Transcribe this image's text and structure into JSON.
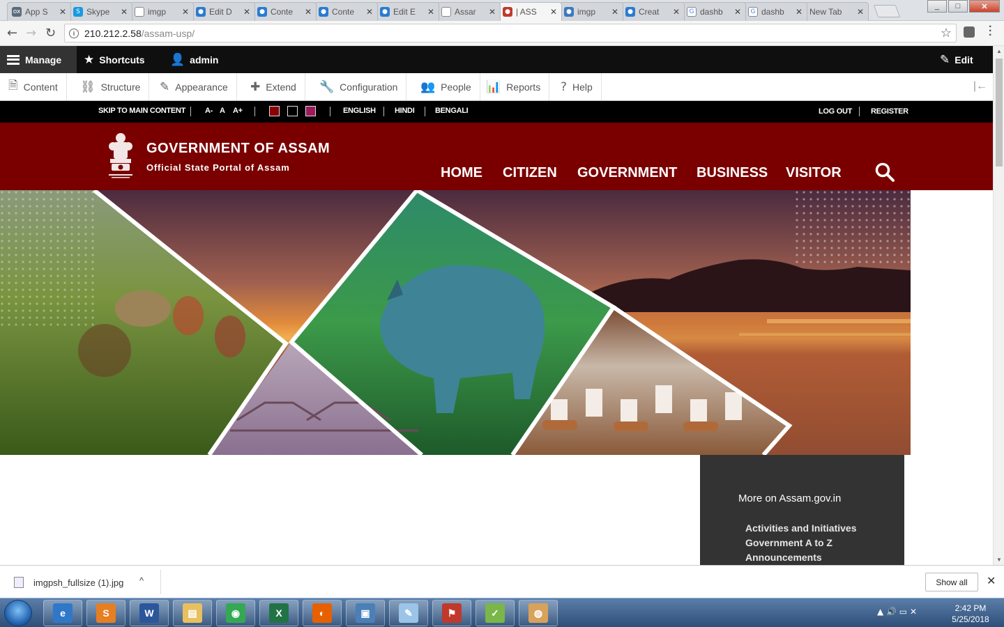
{
  "browser": {
    "tabs": [
      {
        "title": "App S",
        "color": "#5a6b7a",
        "glyph": "ox"
      },
      {
        "title": "Skype",
        "color": "#1a9ae0",
        "glyph": "S"
      },
      {
        "title": "imgp",
        "color": "#ffffff",
        "glyph": ""
      },
      {
        "title": "Edit D",
        "color": "#2a7bd1",
        "glyph": "●"
      },
      {
        "title": "Conte",
        "color": "#2a7bd1",
        "glyph": "●"
      },
      {
        "title": "Conte",
        "color": "#2a7bd1",
        "glyph": "●"
      },
      {
        "title": "Edit E",
        "color": "#2a7bd1",
        "glyph": "●"
      },
      {
        "title": "Assar",
        "color": "#ffffff",
        "glyph": ""
      },
      {
        "title": "| ASS",
        "color": "#c0392b",
        "glyph": "●"
      },
      {
        "title": "imgp",
        "color": "#3a79c0",
        "glyph": "●"
      },
      {
        "title": "Creat",
        "color": "#2a7bd1",
        "glyph": "●"
      },
      {
        "title": "dashb",
        "color": "#ffffff",
        "glyph": "G"
      },
      {
        "title": "dashb",
        "color": "#ffffff",
        "glyph": "G"
      },
      {
        "title": "New Tab",
        "color": "",
        "glyph": ""
      }
    ],
    "tab_close": "✕",
    "url_host": "210.212.2.58",
    "url_path": "/assam-usp/",
    "info_glyph": "i",
    "star_glyph": "☆",
    "back_glyph": "←",
    "forward_glyph": "→",
    "reload_glyph": "↻",
    "min_glyph": "_",
    "max_glyph": "□",
    "close_glyph": "✕"
  },
  "admin_toolbar": {
    "manage": "Manage",
    "shortcuts": "Shortcuts",
    "user": "admin",
    "edit": "Edit",
    "star_glyph": "★",
    "user_glyph": "👤",
    "pencil_glyph": "✎"
  },
  "admin_tray": {
    "items": [
      {
        "label": "Content",
        "glyph": "🗎"
      },
      {
        "label": "Structure",
        "glyph": "⛓"
      },
      {
        "label": "Appearance",
        "glyph": "✎"
      },
      {
        "label": "Extend",
        "glyph": "✚"
      },
      {
        "label": "Configuration",
        "glyph": "🔧"
      },
      {
        "label": "People",
        "glyph": "👥"
      },
      {
        "label": "Reports",
        "glyph": "📊"
      },
      {
        "label": "Help",
        "glyph": "?"
      }
    ],
    "collapse_glyph": "|←"
  },
  "utility_bar": {
    "skip": "SKIP TO MAIN CONTENT",
    "font_small": "A-",
    "font_normal": "A",
    "font_large": "A+",
    "theme_colors": [
      "#8b0000",
      "#000000",
      "#9c1a5c"
    ],
    "lang_english": "ENGLISH",
    "lang_hindi": "HINDI",
    "lang_bengali": "BENGALI",
    "logout": "LOG OUT",
    "register": "REGISTER"
  },
  "header": {
    "title": "GOVERNMENT OF ASSAM",
    "subtitle": "Official State Portal of Assam",
    "nav": [
      "HOME",
      "CITIZEN",
      "GOVERNMENT",
      "BUSINESS",
      "VISITOR"
    ],
    "colors": {
      "brand": "#7a0000"
    }
  },
  "sidebar": {
    "title": "More on Assam.gov.in",
    "links": [
      "Activities and Initiatives",
      "Government A to Z",
      "Announcements"
    ]
  },
  "download_shelf": {
    "file": "imgpsh_fullsize (1).jpg",
    "caret": "^",
    "show_all": "Show all",
    "close_glyph": "✕"
  },
  "taskbar": {
    "apps": [
      {
        "name": "ie-icon",
        "color": "#2f78c8",
        "glyph": "e"
      },
      {
        "name": "sublime-icon",
        "color": "#e67e22",
        "glyph": "S"
      },
      {
        "name": "word-icon",
        "color": "#2b579a",
        "glyph": "W"
      },
      {
        "name": "explorer-icon",
        "color": "#e8c060",
        "glyph": "▤"
      },
      {
        "name": "chrome-icon",
        "color": "#34a853",
        "glyph": "◉"
      },
      {
        "name": "excel-icon",
        "color": "#217346",
        "glyph": "X"
      },
      {
        "name": "firefox-icon",
        "color": "#e66000",
        "glyph": "◐"
      },
      {
        "name": "network-icon",
        "color": "#4a7fb8",
        "glyph": "▣"
      },
      {
        "name": "notepad-icon",
        "color": "#9bc4e8",
        "glyph": "✎"
      },
      {
        "name": "pdf-icon",
        "color": "#c0392b",
        "glyph": "⚑"
      },
      {
        "name": "chart-app-icon",
        "color": "#7ab648",
        "glyph": "✓"
      },
      {
        "name": "paint-icon",
        "color": "#d9a25a",
        "glyph": "◍"
      }
    ],
    "tray_glyphs": "▲  🔊  ▭  ✕",
    "time": "2:42 PM",
    "date": "5/25/2018"
  }
}
